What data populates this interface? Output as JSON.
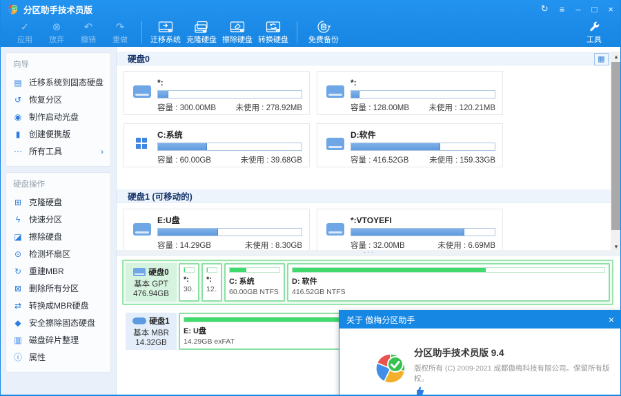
{
  "colors": {
    "primary": "#1787e4",
    "bar_blue": "#6ba4e4",
    "bar_green": "#3fd96e",
    "selected_green": "#97e5ad"
  },
  "titlebar": {
    "title": "分区助手技术员版"
  },
  "icons": {
    "app_check": "✓",
    "discard": "⊗",
    "undo": "↶",
    "redo": "↷",
    "refresh": "↻",
    "menu": "≡",
    "minimize": "–",
    "maximize": "□",
    "close": "×",
    "view_toggle": "▦",
    "chevron": "›",
    "scroll_up": "▴",
    "scroll_down": "▾",
    "splitter_dots": "···",
    "wizard": [
      "▤",
      "↺",
      "◉",
      "▮",
      "⋯"
    ],
    "diskops": [
      "⊞",
      "ϟ",
      "◪",
      "⊙",
      "↻",
      "⊠",
      "⇄",
      "◆",
      "▥",
      "ⓘ"
    ]
  },
  "toolbar": {
    "disabled_actions": [
      {
        "label": "应用"
      },
      {
        "label": "放弃"
      },
      {
        "label": "撤销"
      },
      {
        "label": "重做"
      }
    ],
    "actions": [
      {
        "label": "迁移系统"
      },
      {
        "label": "克隆硬盘"
      },
      {
        "label": "擦除硬盘"
      },
      {
        "label": "转换硬盘"
      },
      {
        "label": "免费备份"
      }
    ],
    "tools_label": "工具"
  },
  "sidebar": {
    "sections": [
      {
        "title": "向导",
        "items": [
          {
            "label": "迁移系统到固态硬盘"
          },
          {
            "label": "恢复分区"
          },
          {
            "label": "制作启动光盘"
          },
          {
            "label": "创建便携版"
          },
          {
            "label": "所有工具"
          }
        ]
      },
      {
        "title": "硬盘操作",
        "items": [
          {
            "label": "克隆硬盘"
          },
          {
            "label": "快速分区"
          },
          {
            "label": "擦除硬盘"
          },
          {
            "label": "检测坏扇区"
          },
          {
            "label": "重建MBR"
          },
          {
            "label": "删除所有分区"
          },
          {
            "label": "转换成MBR硬盘"
          },
          {
            "label": "安全擦除固态硬盘"
          },
          {
            "label": "磁盘碎片整理"
          },
          {
            "label": "属性"
          }
        ]
      }
    ]
  },
  "main": {
    "sections": [
      {
        "title": "硬盘0",
        "cards": [
          {
            "name": "*:",
            "capacity": "容量 : 300.00MB",
            "unused": "未使用 : 278.92MB",
            "used_pct": 7
          },
          {
            "name": "*:",
            "capacity": "容量 : 128.00MB",
            "unused": "未使用 : 120.21MB",
            "used_pct": 6
          },
          {
            "name": "C:系统",
            "capacity": "容量 : 60.00GB",
            "unused": "未使用 : 39.68GB",
            "used_pct": 34
          },
          {
            "name": "D:软件",
            "capacity": "容量 : 416.52GB",
            "unused": "未使用 : 159.33GB",
            "used_pct": 62
          }
        ]
      },
      {
        "title": "硬盘1 (可移动的)",
        "cards": [
          {
            "name": "E:U盘",
            "capacity": "容量 : 14.29GB",
            "unused": "未使用 : 8.30GB",
            "used_pct": 42
          },
          {
            "name": "*:VTOYEFI",
            "capacity": "容量 : 32.00MB",
            "unused": "未使用 : 6.69MB",
            "used_pct": 79
          }
        ]
      }
    ]
  },
  "strip": {
    "disks": [
      {
        "label": "硬盘0",
        "type": "基本 GPT",
        "size": "476.94GB",
        "partitions": [
          {
            "name": "*:",
            "size": "30...",
            "used_pct": 10
          },
          {
            "name": "*:",
            "size": "12...",
            "used_pct": 10
          },
          {
            "name": "C: 系统",
            "size": "60.00GB NTFS",
            "used_pct": 34
          },
          {
            "name": "D: 软件",
            "size": "416.52GB NTFS",
            "used_pct": 62
          }
        ]
      },
      {
        "label": "硬盘1",
        "type": "基本 MBR",
        "size": "14.32GB",
        "partitions": [
          {
            "name": "E: U盘",
            "size": "14.29GB exFAT",
            "used_pct": 42
          }
        ]
      }
    ]
  },
  "dialog": {
    "title": "关于 傲梅分区助手",
    "close": "×",
    "product": "分区助手技术员版 9.4",
    "copyright": "版权所有 (C) 2009-2021 成都傲梅科技有限公司。保留所有版权。"
  }
}
